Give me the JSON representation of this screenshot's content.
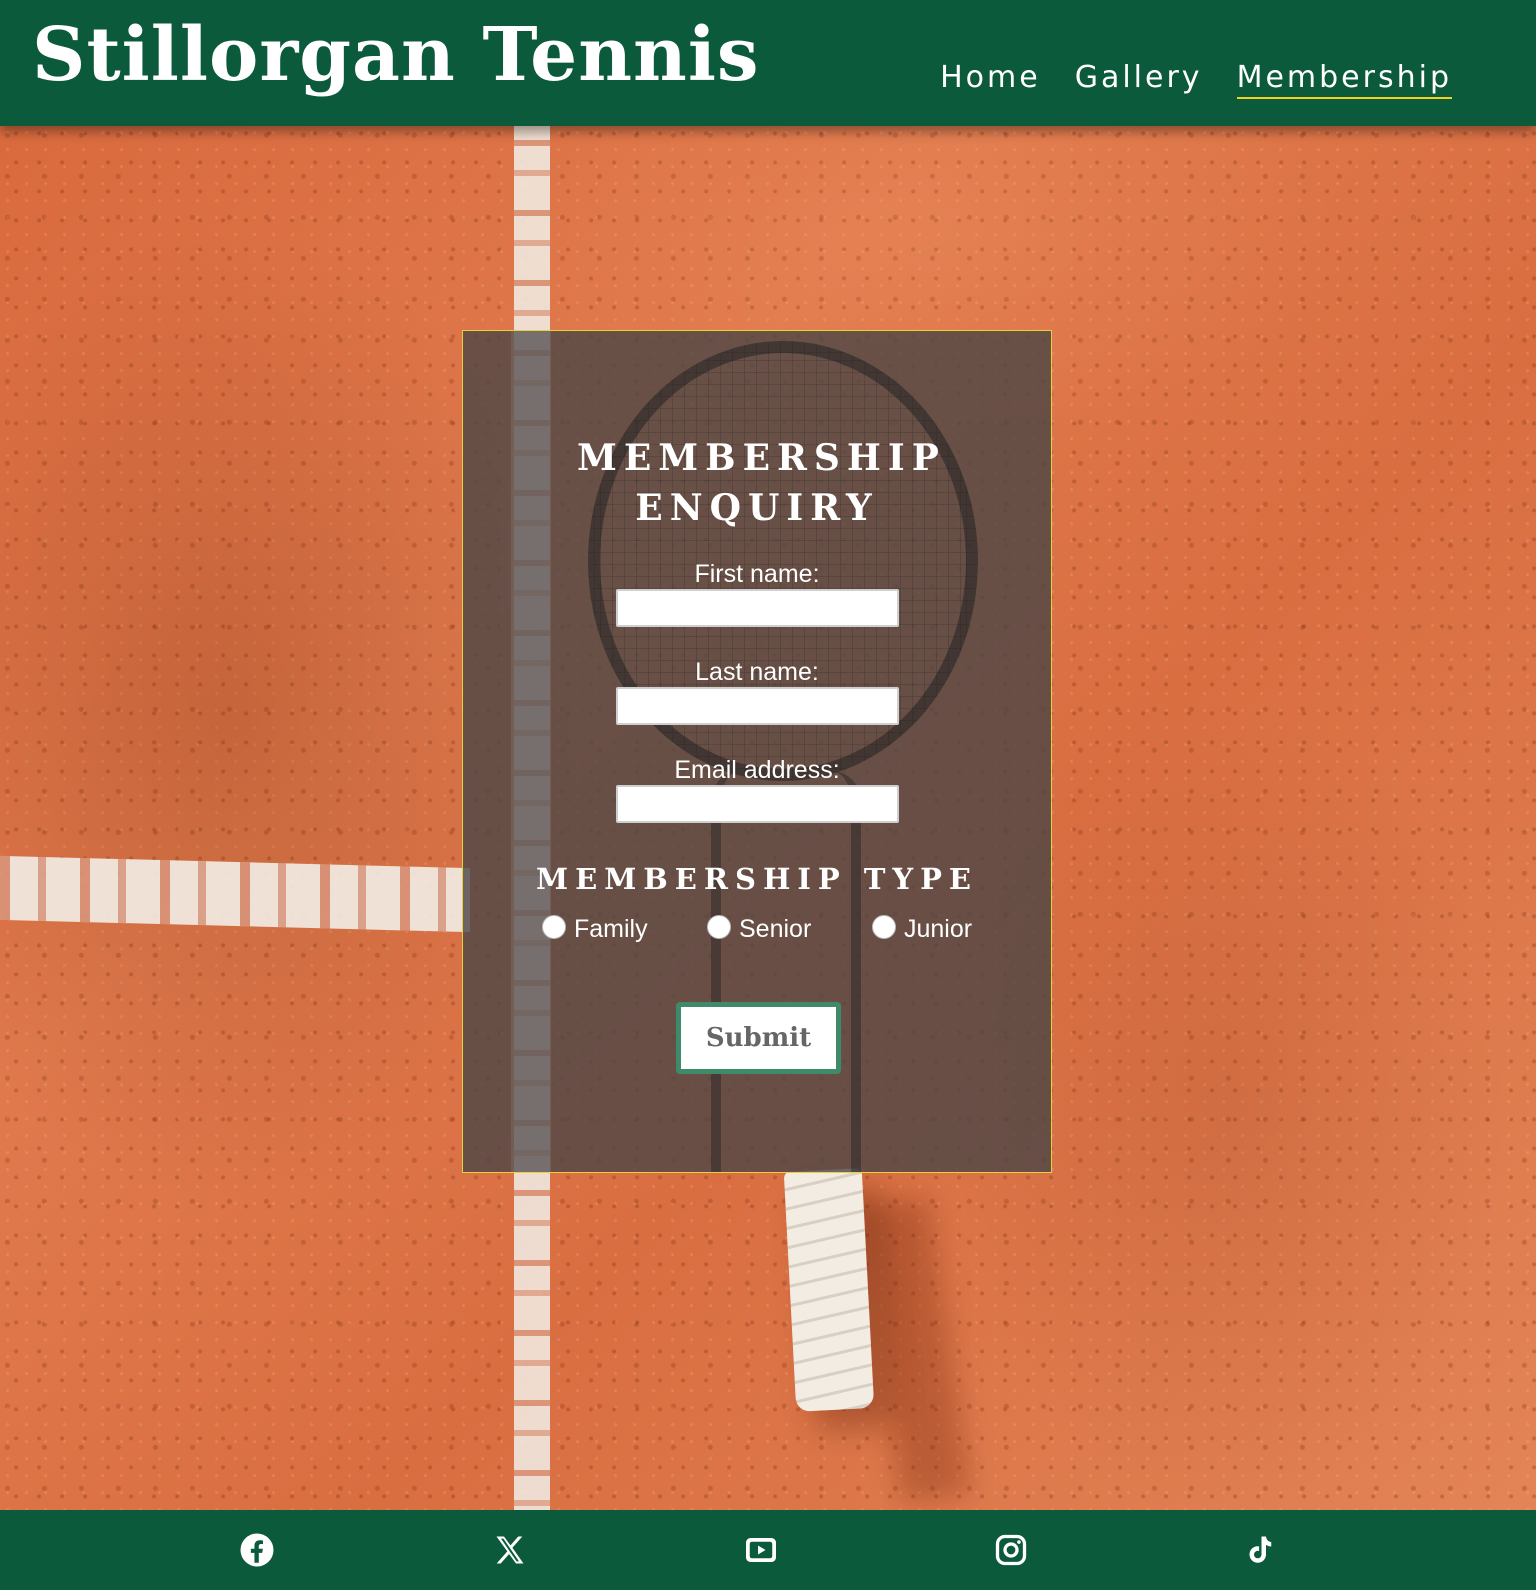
{
  "header": {
    "site_title": "Stillorgan Tennis",
    "nav": [
      {
        "label": "Home"
      },
      {
        "label": "Gallery"
      },
      {
        "label": "Membership",
        "active": true
      }
    ],
    "accent_color": "#f2d31b",
    "brand_color": "#0b5a3c"
  },
  "form": {
    "title": "MEMBERSHIP ENQUIRY",
    "first_name_label": "First name:",
    "first_name_value": "",
    "last_name_label": "Last name:",
    "last_name_value": "",
    "email_label": "Email address:",
    "email_value": "",
    "membership_type_title": "MEMBERSHIP TYPE",
    "membership_options": [
      {
        "label": "Family",
        "selected": false
      },
      {
        "label": "Senior",
        "selected": false
      },
      {
        "label": "Junior",
        "selected": false
      }
    ],
    "submit_label": "Submit"
  },
  "footer": {
    "social_icons": [
      "facebook-icon",
      "x-icon",
      "youtube-icon",
      "instagram-icon",
      "tiktok-icon"
    ]
  }
}
